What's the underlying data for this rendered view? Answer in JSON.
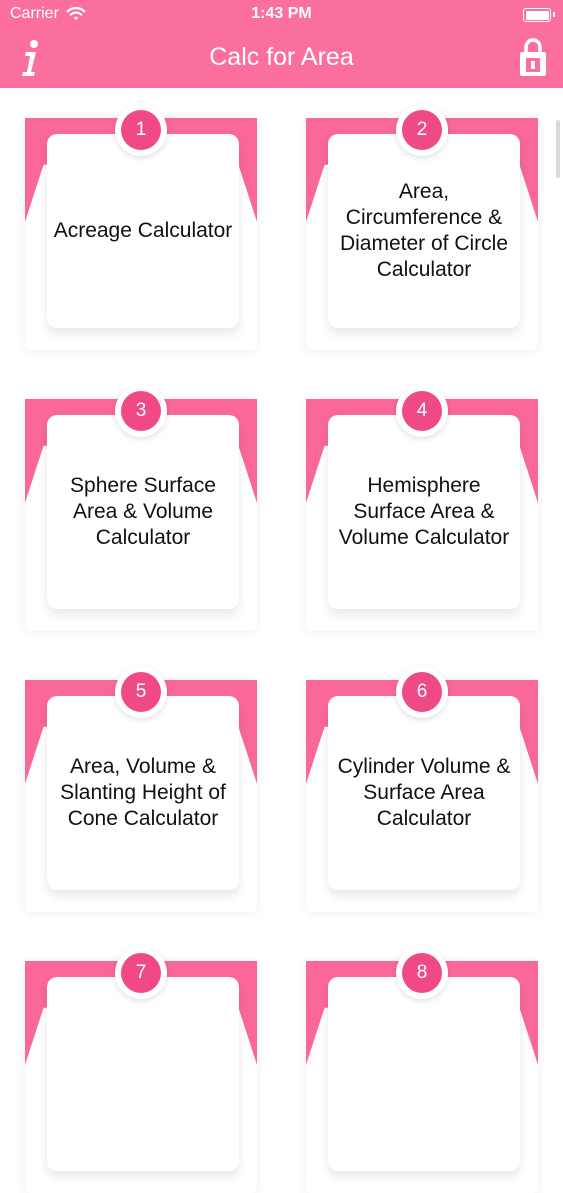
{
  "status_bar": {
    "carrier": "Carrier",
    "time": "1:43 PM"
  },
  "nav": {
    "title": "Calc for Area",
    "info_icon": "info-icon",
    "lock_icon": "lock-icon"
  },
  "colors": {
    "accent": "#fb6fa0",
    "card_pink": "#f9679b",
    "badge": "#f04a86"
  },
  "cards": [
    {
      "number": "1",
      "label": "Acreage Calculator"
    },
    {
      "number": "2",
      "label": "Area, Circumference & Diameter of Circle Calculator"
    },
    {
      "number": "3",
      "label": "Sphere Surface Area & Volume Calculator"
    },
    {
      "number": "4",
      "label": "Hemisphere Surface Area & Volume Calculator"
    },
    {
      "number": "5",
      "label": "Area, Volume & Slanting Height of Cone Calculator"
    },
    {
      "number": "6",
      "label": "Cylinder Volume & Surface Area Calculator"
    },
    {
      "number": "7",
      "label": ""
    },
    {
      "number": "8",
      "label": ""
    }
  ]
}
